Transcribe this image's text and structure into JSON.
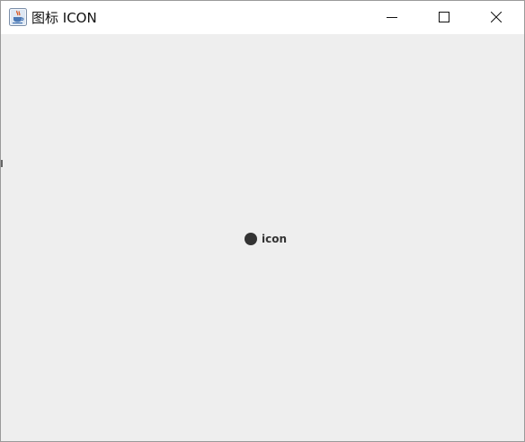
{
  "window": {
    "title": "图标 ICON",
    "app_icon": "java-coffee-icon",
    "controls": {
      "minimize_icon": "minimize-icon",
      "maximize_icon": "maximize-icon",
      "close_icon": "close-icon"
    }
  },
  "content": {
    "label": {
      "text": "icon",
      "icon": "circle-icon",
      "icon_color": "#333333"
    }
  },
  "colors": {
    "titlebar": "#ffffff",
    "background": "#eeeeee",
    "text": "#333333"
  }
}
